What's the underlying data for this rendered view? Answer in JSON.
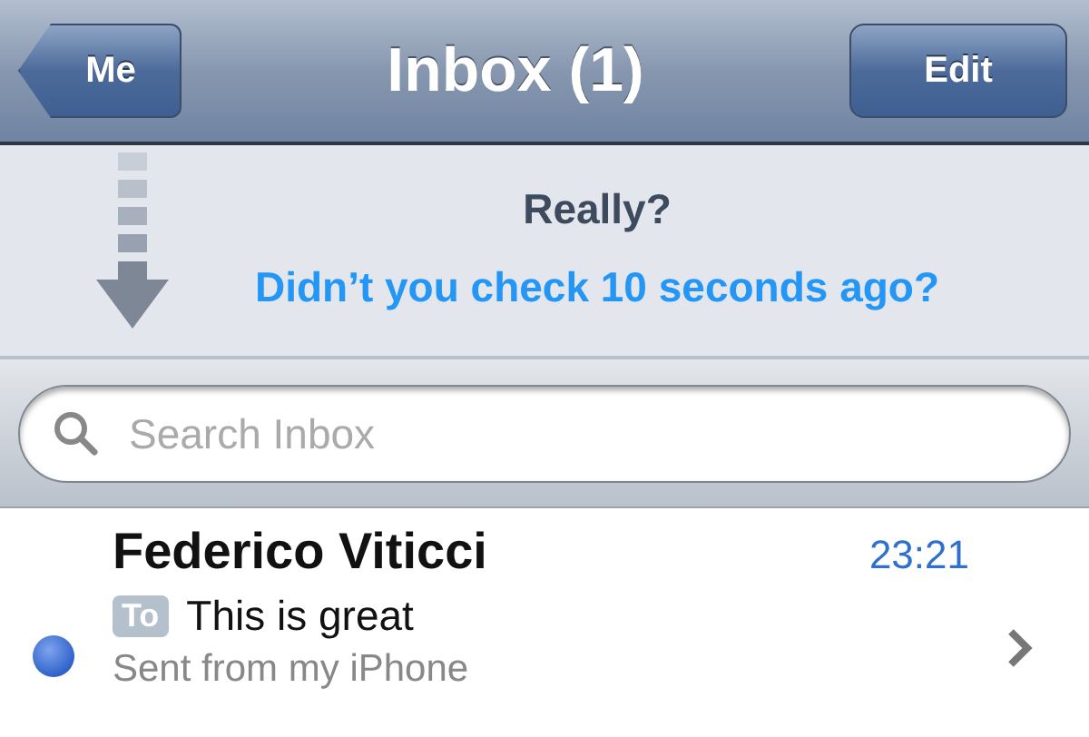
{
  "nav_bar": {
    "back_button": "Me",
    "title": "Inbox (1)",
    "edit_button": "Edit"
  },
  "pull_to_refresh": {
    "title": "Really?",
    "subtitle": "Didn’t you check 10 seconds ago?"
  },
  "search": {
    "placeholder": "Search Inbox"
  },
  "messages": [
    {
      "sender": "Federico Viticci",
      "time": "23:21",
      "tag": "To",
      "subject": "This is great",
      "preview": "Sent from my iPhone",
      "unread": true
    }
  ]
}
